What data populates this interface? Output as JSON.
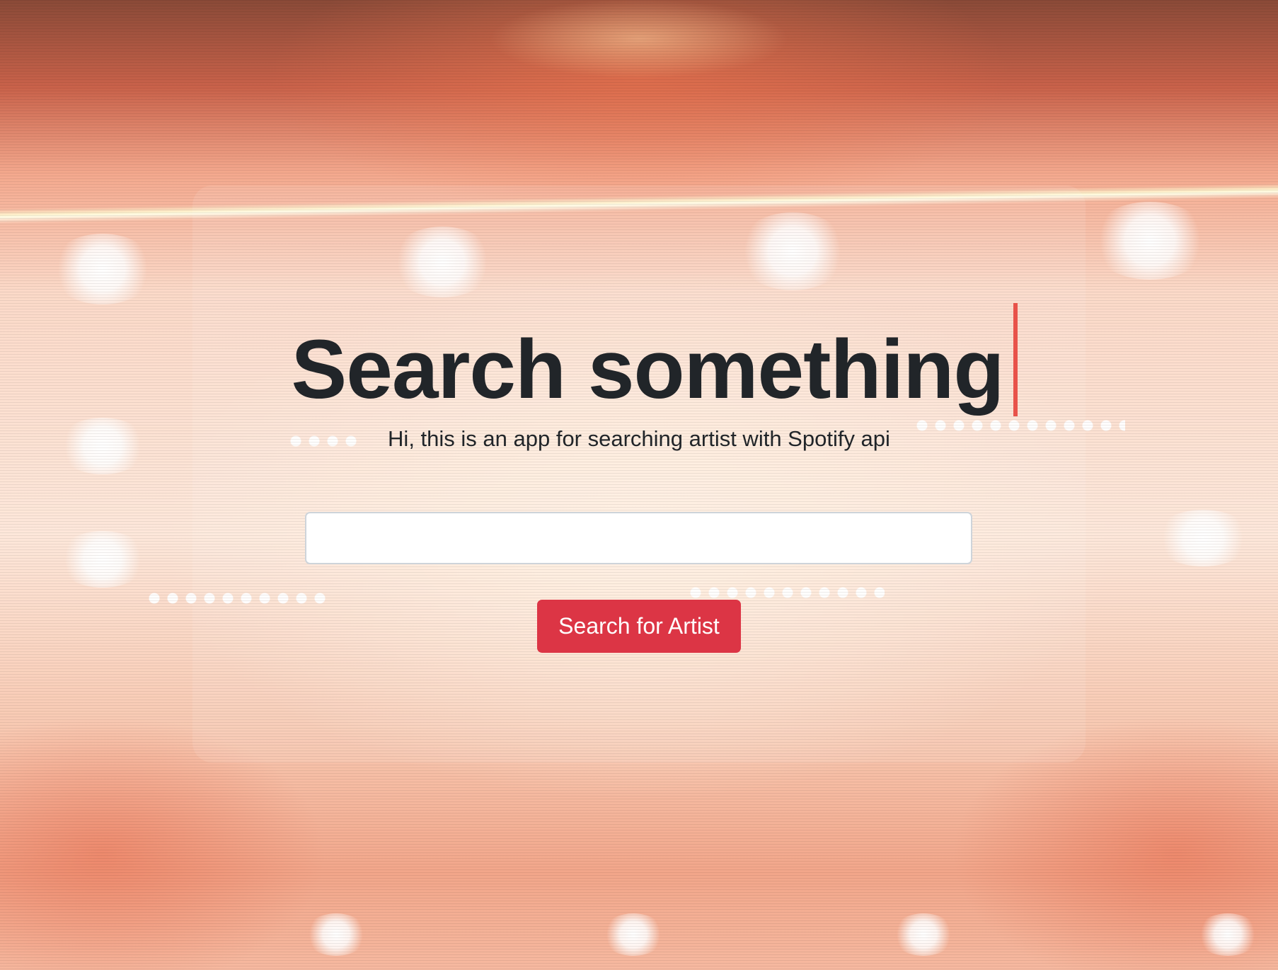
{
  "hero": {
    "title": "Search something",
    "subtitle": "Hi, this is an app for searching artist with Spotify api"
  },
  "search": {
    "value": "",
    "placeholder": "",
    "button_label": "Search for Artist"
  },
  "colors": {
    "button_bg": "#dc3545",
    "caret": "#e8524a",
    "text": "#212529"
  }
}
